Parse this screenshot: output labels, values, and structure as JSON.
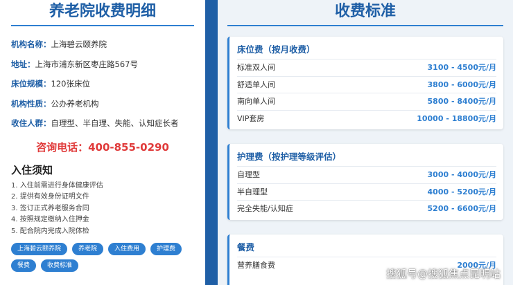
{
  "left": {
    "title": "养老院收费明细",
    "info": [
      {
        "key": "机构名称：",
        "value": "上海碧云颐养院"
      },
      {
        "key": "地址：",
        "value": "上海市浦东新区枣庄路567号"
      },
      {
        "key": "床位规模：",
        "value": "120张床位"
      },
      {
        "key": "机构性质：",
        "value": "公办养老机构"
      },
      {
        "key": "收住人群：",
        "value": "自理型、半自理、失能、认知症长者"
      }
    ],
    "hotline": "咨询电话：400-855-0290",
    "notice_title": "入住须知",
    "notices": [
      "1. 入住前需进行身体健康评估",
      "2. 提供有效身份证明文件",
      "3. 签订正式养老服务合同",
      "4. 按照规定缴纳入住押金",
      "5. 配合院内完成入院体检"
    ],
    "tags": [
      "上海碧云颐养院",
      "养老院",
      "入住费用",
      "护理费",
      "餐费",
      "收费标准"
    ]
  },
  "right": {
    "title": "收费标准",
    "cards": [
      {
        "title": "床位费（按月收费）",
        "rows": [
          {
            "label": "标准双人间",
            "price": "3100 - 4500元/月"
          },
          {
            "label": "舒适单人间",
            "price": "3800 - 6000元/月"
          },
          {
            "label": "南向单人间",
            "price": "5800 - 8400元/月"
          },
          {
            "label": "VIP套房",
            "price": "10000 - 18800元/月"
          }
        ]
      },
      {
        "title": "护理费（按护理等级评估）",
        "rows": [
          {
            "label": "自理型",
            "price": "3000 - 4000元/月"
          },
          {
            "label": "半自理型",
            "price": "4000 - 5200元/月"
          },
          {
            "label": "完全失能/认知症",
            "price": "5200 - 6600元/月"
          }
        ]
      },
      {
        "title": "餐费",
        "rows": [
          {
            "label": "营养膳食费",
            "price": "2000元/月"
          }
        ]
      }
    ]
  },
  "watermark": "搜狐号@搜狐焦点昆明站",
  "colors": {
    "accent": "#2e7fd1",
    "title": "#1f5fa6",
    "hotline": "#e03a3a",
    "background": "#1f5fa6"
  }
}
